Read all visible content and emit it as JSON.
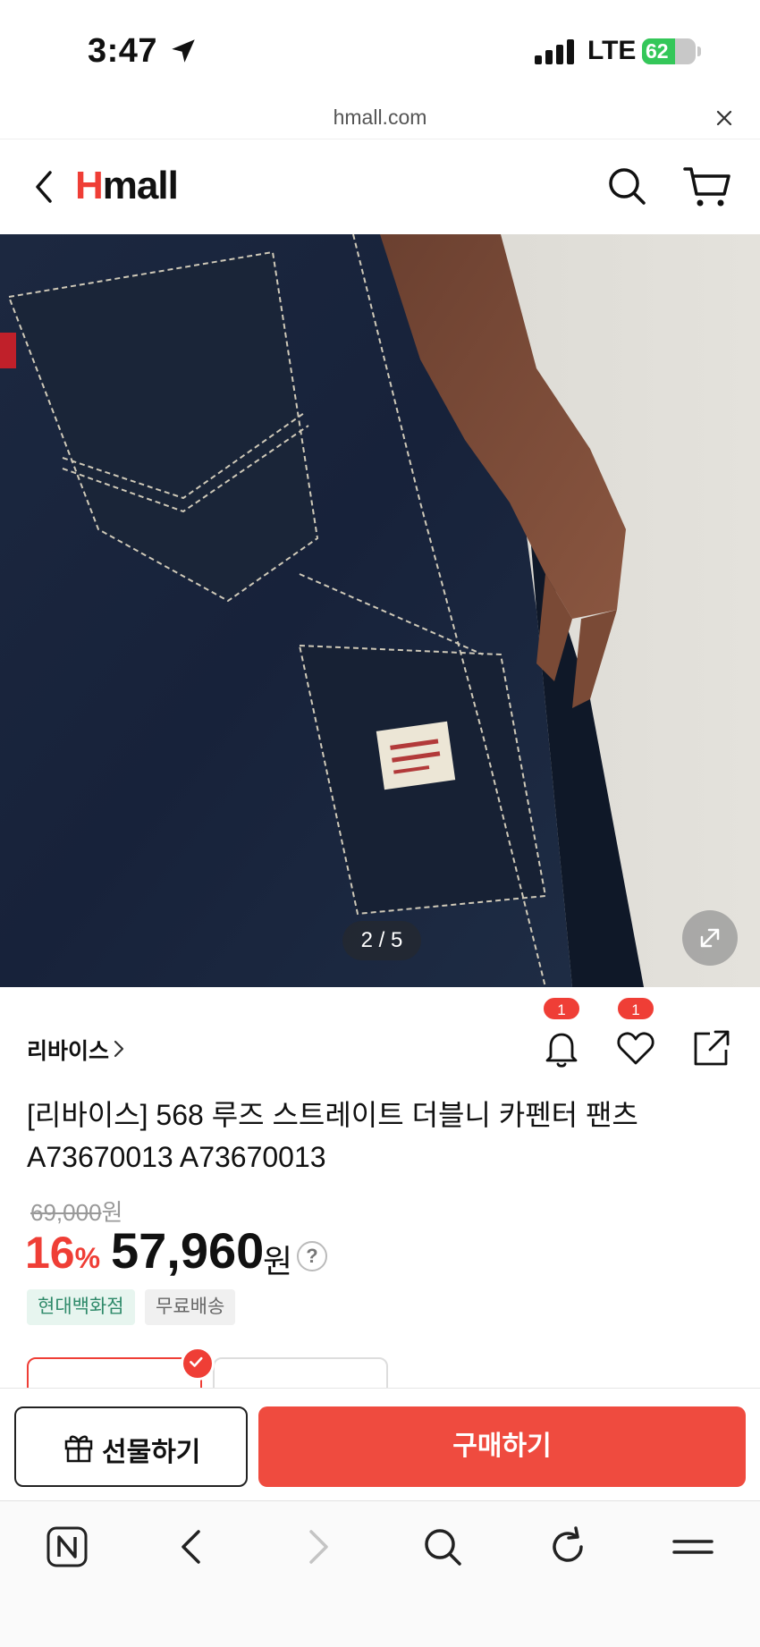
{
  "status_bar": {
    "time": "3:47",
    "network": "LTE",
    "battery": "62",
    "battery_level": 0.62
  },
  "url_bar": {
    "domain": "hmall.com"
  },
  "header": {
    "logo_h": "H",
    "logo_rest": "mall"
  },
  "gallery": {
    "counter": "2 / 5"
  },
  "product": {
    "brand": "리바이스",
    "title": "[리바이스] 568 루즈 스트레이트 더블니 카펜터 팬츠 A73670013 A73670013",
    "original_price": "69,000",
    "original_unit": "원",
    "discount": "16",
    "discount_unit": "%",
    "final_price": "57,960",
    "final_unit": "원",
    "help": "?",
    "tags": [
      "현대백화점",
      "무료배송"
    ],
    "alarm_count": "1",
    "wish_count": "1"
  },
  "actions": {
    "gift_label": "선물하기",
    "buy_label": "구매하기"
  },
  "colors": {
    "accent": "#ef3e36",
    "buy_button": "#ef4b3f",
    "store_tag_bg": "#e7f5ef",
    "store_tag_text": "#2f8a6a"
  },
  "icons": {
    "back": "chevron-left-icon",
    "search": "search-icon",
    "cart": "cart-icon",
    "expand": "expand-icon",
    "alarm": "bell-icon",
    "wish": "heart-icon",
    "share": "share-icon",
    "gift": "gift-icon",
    "browser_home": "naver-icon",
    "browser_back": "back-icon",
    "browser_forward": "forward-icon",
    "browser_search": "search-icon",
    "browser_reload": "reload-icon",
    "browser_menu": "menu-icon"
  }
}
